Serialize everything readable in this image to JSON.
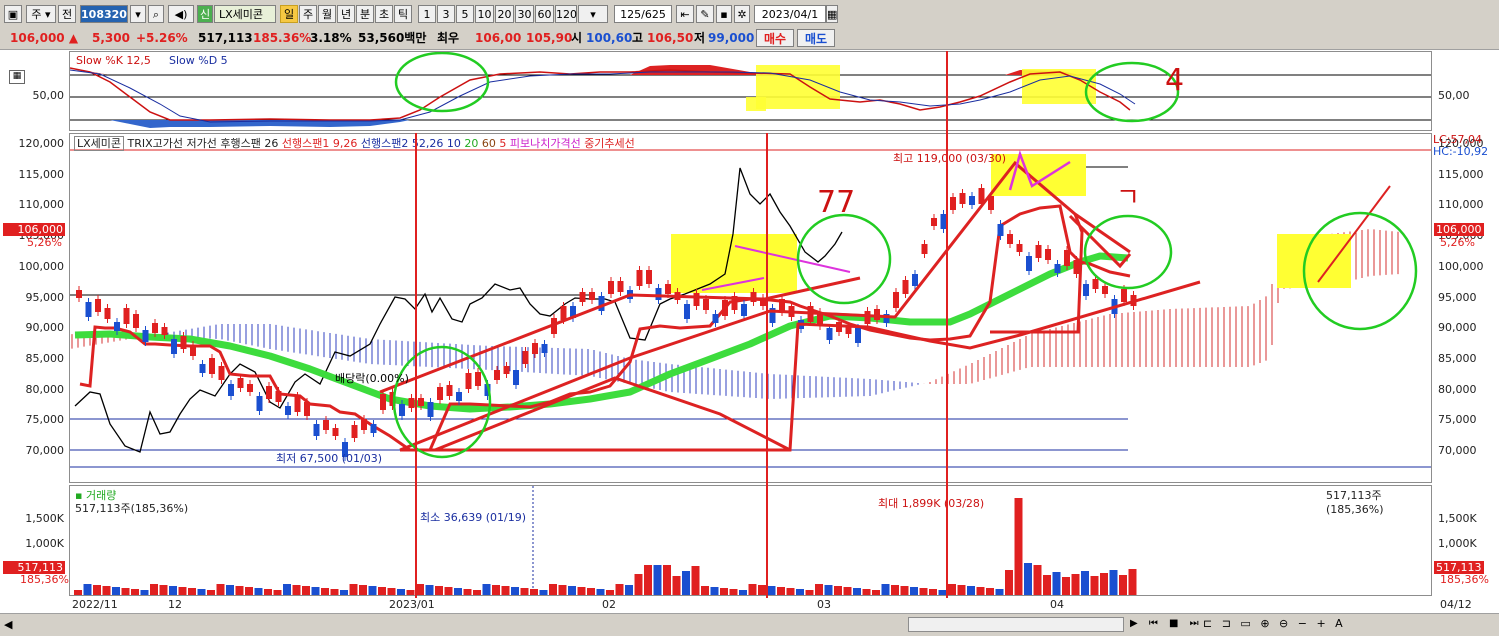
{
  "toolbar": {
    "market": "주",
    "period_label": "전",
    "stock_code": "108320",
    "stock_name": "LX세미콘",
    "credit_badge": "신",
    "buttons": [
      "일",
      "주",
      "월",
      "년",
      "분",
      "초",
      "틱"
    ],
    "intervals": [
      "1",
      "3",
      "5",
      "10",
      "20",
      "30",
      "60",
      "120"
    ],
    "count": "125",
    "total": "/625",
    "date": "2023/04/1"
  },
  "quote": {
    "price": "106,000",
    "arrow": "▲",
    "change": "5,300",
    "change_pct": "+5.26%",
    "volume": "517,113",
    "volume_ratio": "185.36%",
    "turnover": "3.18%",
    "amount": "53,560백만",
    "lowlabel": "최우",
    "best1": "106,00",
    "best2": "105,90",
    "open_lbl": "시",
    "open": "100,60",
    "high_lbl": "고",
    "high": "106,50",
    "low_lbl": "저",
    "low": "99,000",
    "buy": "매수",
    "sell": "매도"
  },
  "stoch": {
    "title1": "Slow %K 12,5",
    "title2": "Slow %D 5",
    "level": "50,00"
  },
  "price_panel": {
    "legend": [
      "LX세미콘",
      "TRIX고가선",
      "저가선",
      "후행스팬 26",
      "선행스팬1 9,26",
      "선행스팬2 52,26",
      "10",
      "20",
      "60",
      "5",
      "피보나치가격선",
      "중기추세선"
    ],
    "yticks": [
      "120,000",
      "115,000",
      "110,000",
      "105,000",
      "100,000",
      "95,000",
      "90,000",
      "85,000",
      "80,000",
      "75,000",
      "70,000"
    ],
    "high_label": "최고 119,000 (03/30)",
    "low_label": "최저 67,500 (01/03)",
    "dividend_label": "배당락(0.00%)",
    "lc": "LC:57,04",
    "hc": "HC:-10,92",
    "price_tag": "106,000",
    "pct_tag": "5,26%",
    "annotations": [
      "77",
      "ㄱ",
      "4"
    ]
  },
  "volume_panel": {
    "title": "거래량",
    "subtitle": "517,113주(185,36%)",
    "right_label": "517,113주(185,36%)",
    "yticks": [
      "1,500K",
      "1,000K"
    ],
    "max_label": "최대 1,899K (03/28)",
    "min_label": "최소 36,639 (01/19)",
    "vol_tag": "517,113",
    "pct_tag": "185,36%"
  },
  "xaxis": {
    "labels": [
      "2022/11",
      "12",
      "2023/01",
      "02",
      "03",
      "04"
    ],
    "right": "04/12"
  },
  "colors": {
    "up": "#e02020",
    "down": "#1a4fd0",
    "cloud_red": "#d43030",
    "cloud_blue": "#3040c0",
    "ma_green": "#3ddc3d",
    "highlight": "#ffff33"
  }
}
